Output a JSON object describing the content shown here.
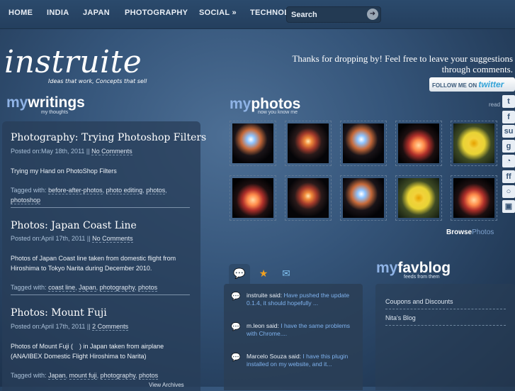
{
  "nav": {
    "items": [
      "HOME",
      "INDIA",
      "JAPAN",
      "PHOTOGRAPHY",
      "SOCIAL »",
      "TECHNOLOGY"
    ],
    "search_placeholder": "Search"
  },
  "header": {
    "logo": "instruite",
    "tagline": "Ideas that work, Concepts that sell",
    "thanks_line1": "Thanks for dropping by! Feel free to leave your suggestions",
    "thanks_line2": "through comments.",
    "twitter_prefix": "FOLLOW ME ON",
    "twitter_brand": "twitter"
  },
  "writings": {
    "head_a": "my",
    "head_b": "writings",
    "sub": "my thoughts",
    "posts": [
      {
        "title": "Photography: Trying Photoshop Filters",
        "date_prefix": "Posted on:May 18th, 2011 ||",
        "comments": "No Comments",
        "body": "Trying my Hand on PhotoShop Filters",
        "tags_prefix": "Tagged with:",
        "tags": [
          "before-after-photos",
          "photo editing",
          "photos",
          "photoshop"
        ]
      },
      {
        "title": "Photos: Japan Coast Line",
        "date_prefix": "Posted on:April 17th, 2011 ||",
        "comments": "No Comments",
        "body": "Photos of Japan Coast line taken from domestic flight from Hiroshima to Tokyo Narita during December 2010.",
        "tags_prefix": "Tagged with:",
        "tags": [
          "coast line",
          "Japan",
          "photography",
          "photos"
        ]
      },
      {
        "title": "Photos: Mount Fuji",
        "date_prefix": "Posted on:April 17th, 2011 ||",
        "comments": "2 Comments",
        "body": "Photos of Mount Fuji (　) in Japan taken from airplane (ANA/IBEX Domestic Flight Hiroshima to Narita)",
        "tags_prefix": "Tagged with:",
        "tags": [
          "Japan",
          "mount fuji",
          "photography",
          "photos"
        ]
      }
    ],
    "view_archives": "View Archives"
  },
  "photos": {
    "head_a": "my",
    "head_b": "photos",
    "sub": "now you know me",
    "browse_a": "Browse",
    "browse_b": "Photos"
  },
  "social": {
    "read_label": "read",
    "icons": [
      "twitter-icon",
      "facebook-icon",
      "stumbleupon-icon",
      "google-icon",
      "rss-icon",
      "friendfeed-icon",
      "chat-icon",
      "myspace-icon"
    ],
    "glyphs": [
      "t",
      "f",
      "su",
      "g",
      "◔",
      "ff",
      "○",
      "▣"
    ]
  },
  "comments": {
    "items": [
      {
        "author": "instruite",
        "said": "said:",
        "msg": "Have pushed the update 0.1.4, it should hopefully ..."
      },
      {
        "author": "m.leon",
        "said": "said:",
        "msg": "I have the same problems with Chrome...."
      },
      {
        "author": "Marcelo Souza",
        "said": "said:",
        "msg": "I have this plugin installed on my website, and it..."
      }
    ]
  },
  "favblog": {
    "head_a": "my",
    "head_b": "favblog",
    "sub": "feeds from them",
    "links": [
      "Coupons and Discounts",
      "Nita's Blog"
    ]
  }
}
